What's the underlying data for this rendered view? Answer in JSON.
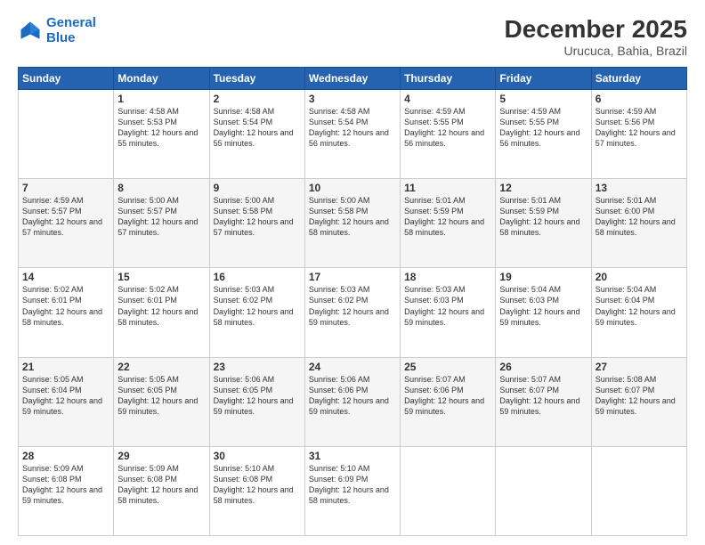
{
  "header": {
    "logo_line1": "General",
    "logo_line2": "Blue",
    "month": "December 2025",
    "location": "Urucuca, Bahia, Brazil"
  },
  "weekdays": [
    "Sunday",
    "Monday",
    "Tuesday",
    "Wednesday",
    "Thursday",
    "Friday",
    "Saturday"
  ],
  "weeks": [
    [
      {
        "day": "",
        "sunrise": "",
        "sunset": "",
        "daylight": ""
      },
      {
        "day": "1",
        "sunrise": "Sunrise: 4:58 AM",
        "sunset": "Sunset: 5:53 PM",
        "daylight": "Daylight: 12 hours and 55 minutes."
      },
      {
        "day": "2",
        "sunrise": "Sunrise: 4:58 AM",
        "sunset": "Sunset: 5:54 PM",
        "daylight": "Daylight: 12 hours and 55 minutes."
      },
      {
        "day": "3",
        "sunrise": "Sunrise: 4:58 AM",
        "sunset": "Sunset: 5:54 PM",
        "daylight": "Daylight: 12 hours and 56 minutes."
      },
      {
        "day": "4",
        "sunrise": "Sunrise: 4:59 AM",
        "sunset": "Sunset: 5:55 PM",
        "daylight": "Daylight: 12 hours and 56 minutes."
      },
      {
        "day": "5",
        "sunrise": "Sunrise: 4:59 AM",
        "sunset": "Sunset: 5:55 PM",
        "daylight": "Daylight: 12 hours and 56 minutes."
      },
      {
        "day": "6",
        "sunrise": "Sunrise: 4:59 AM",
        "sunset": "Sunset: 5:56 PM",
        "daylight": "Daylight: 12 hours and 57 minutes."
      }
    ],
    [
      {
        "day": "7",
        "sunrise": "Sunrise: 4:59 AM",
        "sunset": "Sunset: 5:57 PM",
        "daylight": "Daylight: 12 hours and 57 minutes."
      },
      {
        "day": "8",
        "sunrise": "Sunrise: 5:00 AM",
        "sunset": "Sunset: 5:57 PM",
        "daylight": "Daylight: 12 hours and 57 minutes."
      },
      {
        "day": "9",
        "sunrise": "Sunrise: 5:00 AM",
        "sunset": "Sunset: 5:58 PM",
        "daylight": "Daylight: 12 hours and 57 minutes."
      },
      {
        "day": "10",
        "sunrise": "Sunrise: 5:00 AM",
        "sunset": "Sunset: 5:58 PM",
        "daylight": "Daylight: 12 hours and 58 minutes."
      },
      {
        "day": "11",
        "sunrise": "Sunrise: 5:01 AM",
        "sunset": "Sunset: 5:59 PM",
        "daylight": "Daylight: 12 hours and 58 minutes."
      },
      {
        "day": "12",
        "sunrise": "Sunrise: 5:01 AM",
        "sunset": "Sunset: 5:59 PM",
        "daylight": "Daylight: 12 hours and 58 minutes."
      },
      {
        "day": "13",
        "sunrise": "Sunrise: 5:01 AM",
        "sunset": "Sunset: 6:00 PM",
        "daylight": "Daylight: 12 hours and 58 minutes."
      }
    ],
    [
      {
        "day": "14",
        "sunrise": "Sunrise: 5:02 AM",
        "sunset": "Sunset: 6:01 PM",
        "daylight": "Daylight: 12 hours and 58 minutes."
      },
      {
        "day": "15",
        "sunrise": "Sunrise: 5:02 AM",
        "sunset": "Sunset: 6:01 PM",
        "daylight": "Daylight: 12 hours and 58 minutes."
      },
      {
        "day": "16",
        "sunrise": "Sunrise: 5:03 AM",
        "sunset": "Sunset: 6:02 PM",
        "daylight": "Daylight: 12 hours and 58 minutes."
      },
      {
        "day": "17",
        "sunrise": "Sunrise: 5:03 AM",
        "sunset": "Sunset: 6:02 PM",
        "daylight": "Daylight: 12 hours and 59 minutes."
      },
      {
        "day": "18",
        "sunrise": "Sunrise: 5:03 AM",
        "sunset": "Sunset: 6:03 PM",
        "daylight": "Daylight: 12 hours and 59 minutes."
      },
      {
        "day": "19",
        "sunrise": "Sunrise: 5:04 AM",
        "sunset": "Sunset: 6:03 PM",
        "daylight": "Daylight: 12 hours and 59 minutes."
      },
      {
        "day": "20",
        "sunrise": "Sunrise: 5:04 AM",
        "sunset": "Sunset: 6:04 PM",
        "daylight": "Daylight: 12 hours and 59 minutes."
      }
    ],
    [
      {
        "day": "21",
        "sunrise": "Sunrise: 5:05 AM",
        "sunset": "Sunset: 6:04 PM",
        "daylight": "Daylight: 12 hours and 59 minutes."
      },
      {
        "day": "22",
        "sunrise": "Sunrise: 5:05 AM",
        "sunset": "Sunset: 6:05 PM",
        "daylight": "Daylight: 12 hours and 59 minutes."
      },
      {
        "day": "23",
        "sunrise": "Sunrise: 5:06 AM",
        "sunset": "Sunset: 6:05 PM",
        "daylight": "Daylight: 12 hours and 59 minutes."
      },
      {
        "day": "24",
        "sunrise": "Sunrise: 5:06 AM",
        "sunset": "Sunset: 6:06 PM",
        "daylight": "Daylight: 12 hours and 59 minutes."
      },
      {
        "day": "25",
        "sunrise": "Sunrise: 5:07 AM",
        "sunset": "Sunset: 6:06 PM",
        "daylight": "Daylight: 12 hours and 59 minutes."
      },
      {
        "day": "26",
        "sunrise": "Sunrise: 5:07 AM",
        "sunset": "Sunset: 6:07 PM",
        "daylight": "Daylight: 12 hours and 59 minutes."
      },
      {
        "day": "27",
        "sunrise": "Sunrise: 5:08 AM",
        "sunset": "Sunset: 6:07 PM",
        "daylight": "Daylight: 12 hours and 59 minutes."
      }
    ],
    [
      {
        "day": "28",
        "sunrise": "Sunrise: 5:09 AM",
        "sunset": "Sunset: 6:08 PM",
        "daylight": "Daylight: 12 hours and 59 minutes."
      },
      {
        "day": "29",
        "sunrise": "Sunrise: 5:09 AM",
        "sunset": "Sunset: 6:08 PM",
        "daylight": "Daylight: 12 hours and 58 minutes."
      },
      {
        "day": "30",
        "sunrise": "Sunrise: 5:10 AM",
        "sunset": "Sunset: 6:08 PM",
        "daylight": "Daylight: 12 hours and 58 minutes."
      },
      {
        "day": "31",
        "sunrise": "Sunrise: 5:10 AM",
        "sunset": "Sunset: 6:09 PM",
        "daylight": "Daylight: 12 hours and 58 minutes."
      },
      {
        "day": "",
        "sunrise": "",
        "sunset": "",
        "daylight": ""
      },
      {
        "day": "",
        "sunrise": "",
        "sunset": "",
        "daylight": ""
      },
      {
        "day": "",
        "sunrise": "",
        "sunset": "",
        "daylight": ""
      }
    ]
  ]
}
